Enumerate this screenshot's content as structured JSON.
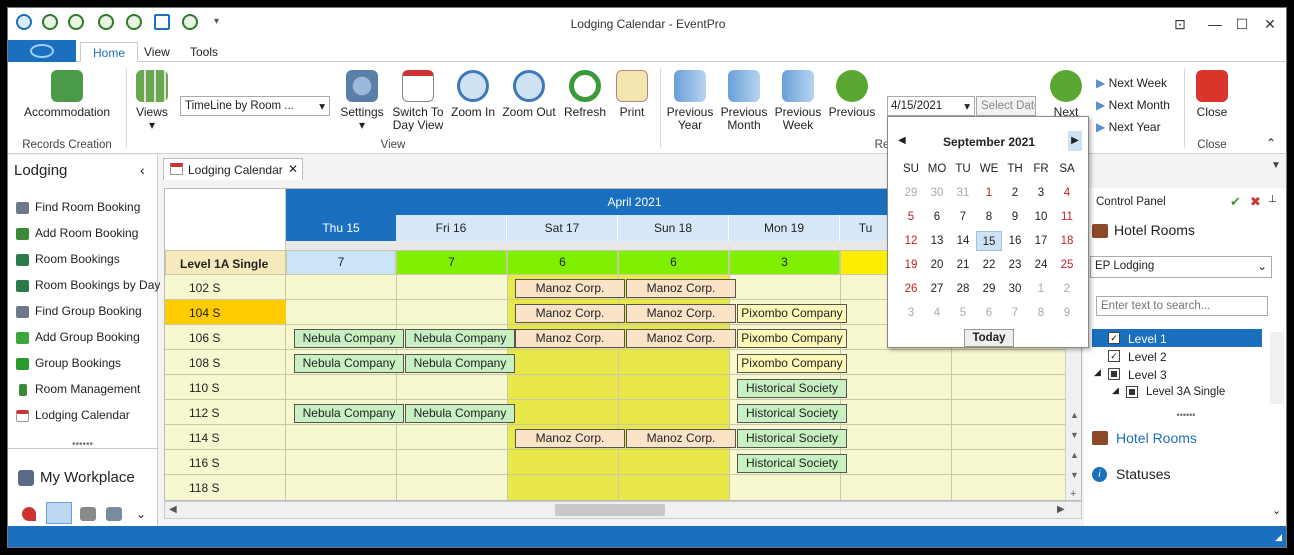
{
  "window": {
    "title": "Lodging Calendar - EventPro"
  },
  "ribbon_tabs": [
    "Home",
    "View",
    "Tools"
  ],
  "ribbon": {
    "accommodation": "Accommodation",
    "records_creation": "Records Creation",
    "views": "Views",
    "view_combo": "TimeLine by Room ...",
    "settings": "Settings",
    "switch_to_day_view": "Switch To Day View",
    "zoom_in": "Zoom In",
    "zoom_out": "Zoom Out",
    "refresh": "Refresh",
    "print": "Print",
    "view_group": "View",
    "previous_year": "Previous Year",
    "previous_month": "Previous Month",
    "previous_week": "Previous Week",
    "previous": "Previous",
    "date_value": "4/15/2021",
    "select_date": "Select Date",
    "next_label": "Next",
    "next_week": "Next Week",
    "next_month": "Next Month",
    "next_year": "Next Year",
    "close": "Close",
    "close_group": "Close",
    "re_group": "Re"
  },
  "left_pane": {
    "title": "Lodging",
    "items": [
      "Find Room Booking",
      "Add Room Booking",
      "Room Bookings",
      "Room Bookings by Day",
      "Find Group Booking",
      "Add Group Booking",
      "Group Bookings",
      "Room Management",
      "Lodging Calendar"
    ],
    "workplace": "My Workplace"
  },
  "doc_tab": {
    "label": "Lodging Calendar"
  },
  "calendar": {
    "month": "April 2021",
    "days": [
      "Thu 15",
      "Fri 16",
      "Sat 17",
      "Sun 18",
      "Mon 19",
      "Tu"
    ],
    "level_label": "Level 1A Single",
    "availability": [
      "7",
      "7",
      "6",
      "6",
      "3",
      ""
    ],
    "rooms": [
      "102 S",
      "104 S",
      "106 S",
      "108 S",
      "110 S",
      "112 S",
      "114 S",
      "116 S",
      "118 S"
    ],
    "bookings": {
      "manoz": "Manoz Corp.",
      "nebula": "Nebula Company",
      "pix": "Pixombo Company",
      "hist": "Historical Society"
    }
  },
  "date_picker": {
    "month_title": "September 2021",
    "weekdays": [
      "SU",
      "MO",
      "TU",
      "WE",
      "TH",
      "FR",
      "SA"
    ],
    "weeks": [
      [
        "29",
        "30",
        "31",
        "1",
        "2",
        "3",
        "4"
      ],
      [
        "5",
        "6",
        "7",
        "8",
        "9",
        "10",
        "11"
      ],
      [
        "12",
        "13",
        "14",
        "15",
        "16",
        "17",
        "18"
      ],
      [
        "19",
        "20",
        "21",
        "22",
        "23",
        "24",
        "25"
      ],
      [
        "26",
        "27",
        "28",
        "29",
        "30",
        "1",
        "2"
      ],
      [
        "3",
        "4",
        "5",
        "6",
        "7",
        "8",
        "9"
      ]
    ],
    "today_button": "Today"
  },
  "right_pane": {
    "title": "Control Panel",
    "hotel_rooms": "Hotel Rooms",
    "combo": "EP Lodging",
    "search_placeholder": "Enter text to search...",
    "tree": [
      "Level 1",
      "Level 2",
      "Level 3",
      "Level 3A Single"
    ],
    "link_hotel_rooms": "Hotel Rooms",
    "statuses": "Statuses"
  },
  "colors": {
    "accent": "#1a6fbe",
    "avail_green": "#7ff000",
    "avail_yellow": "#ffee00",
    "avail_blue": "#cce4f7",
    "weekend": "#e8e84a",
    "cell": "#f7f7d0"
  }
}
